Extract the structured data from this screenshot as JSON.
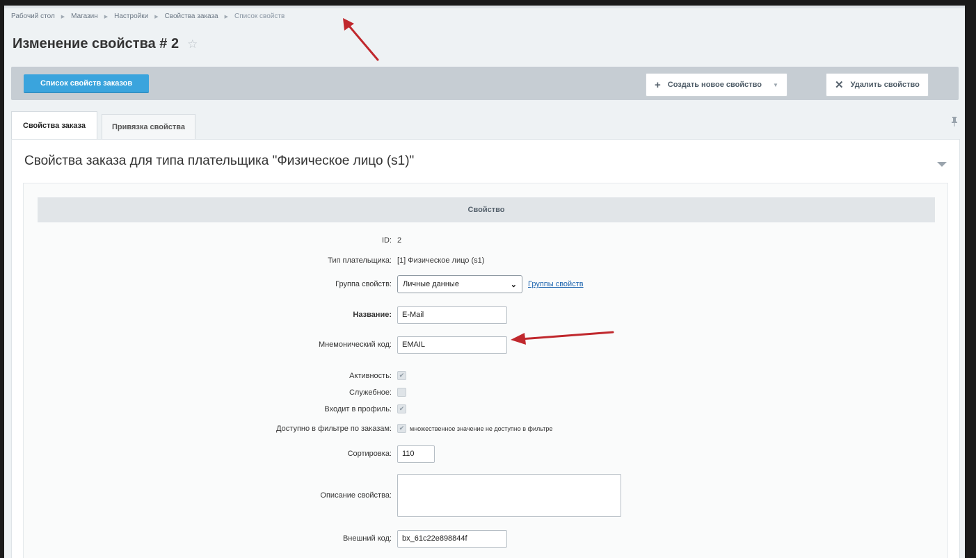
{
  "breadcrumb": [
    "Рабочий стол",
    "Магазин",
    "Настройки",
    "Свойства заказа",
    "Список свойств"
  ],
  "page": {
    "title": "Изменение свойства # 2",
    "star": "☆"
  },
  "toolbar": {
    "list_button": "Список свойств заказов",
    "create_button": "Создать новое свойство",
    "create_icon": "+",
    "delete_button": "Удалить свойство",
    "delete_icon": "✕"
  },
  "tabs": [
    {
      "label": "Свойства заказа",
      "active": true
    },
    {
      "label": "Привязка свойства",
      "active": false
    }
  ],
  "panel": {
    "heading": "Свойства заказа для типа плательщика \"Физическое лицо (s1)\""
  },
  "section": {
    "title": "Свойство"
  },
  "form": {
    "id_label": "ID:",
    "id_value": "2",
    "payer_label": "Тип плательщика:",
    "payer_value": "[1] Физическое лицо (s1)",
    "group_label": "Группа свойств:",
    "group_value": "Личные данные",
    "group_link": "Группы свойств",
    "name_label": "Название:",
    "name_value": "E-Mail",
    "code_label": "Мнемонический код:",
    "code_value": "EMAIL",
    "active_label": "Активность:",
    "active_checked": true,
    "service_label": "Служебное:",
    "service_checked": false,
    "profile_label": "Входит в профиль:",
    "profile_checked": true,
    "filter_label": "Доступно в фильтре по заказам:",
    "filter_checked": true,
    "filter_hint": "множественное значение не доступно в фильтре",
    "sort_label": "Сортировка:",
    "sort_value": "110",
    "description_label": "Описание свойства:",
    "description_value": "",
    "external_label": "Внешний код:",
    "external_value": "bx_61c22e898844f"
  },
  "colors": {
    "accent": "#3aa4dd",
    "annotation_arrow": "#c0282d",
    "link": "#2067b0"
  }
}
